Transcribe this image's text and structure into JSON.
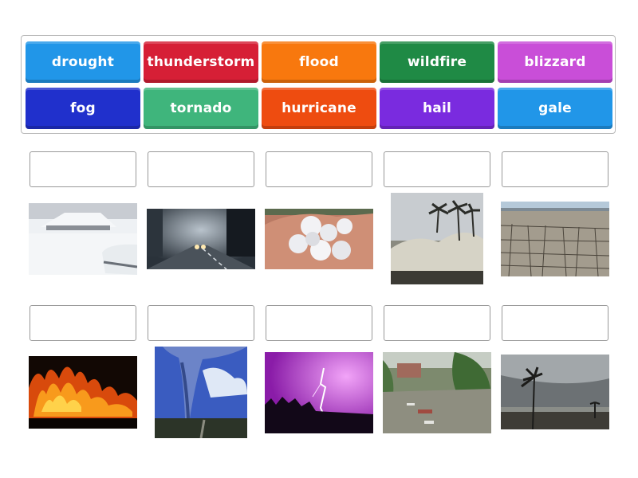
{
  "word_bank": {
    "tiles": [
      {
        "label": "drought",
        "color": "#2196e8"
      },
      {
        "label": "thunderstorm",
        "color": "#d61f36"
      },
      {
        "label": "flood",
        "color": "#f8780e"
      },
      {
        "label": "wildfire",
        "color": "#1f8a45"
      },
      {
        "label": "blizzard",
        "color": "#c94ed8"
      },
      {
        "label": "fog",
        "color": "#2030cc"
      },
      {
        "label": "tornado",
        "color": "#3fb57c"
      },
      {
        "label": "hurricane",
        "color": "#ee4c10"
      },
      {
        "label": "hail",
        "color": "#7a2bdf"
      },
      {
        "label": "gale",
        "color": "#2196e8"
      }
    ]
  },
  "targets": [
    {
      "image": "blizzard-snow-image"
    },
    {
      "image": "fog-road-image"
    },
    {
      "image": "hailstones-hand-image"
    },
    {
      "image": "hurricane-waves-palms-image"
    },
    {
      "image": "drought-cracked-earth-image"
    },
    {
      "image": "wildfire-flames-image"
    },
    {
      "image": "tornado-funnel-image"
    },
    {
      "image": "thunderstorm-lightning-image"
    },
    {
      "image": "flood-street-image"
    },
    {
      "image": "gale-palm-storm-image"
    }
  ]
}
